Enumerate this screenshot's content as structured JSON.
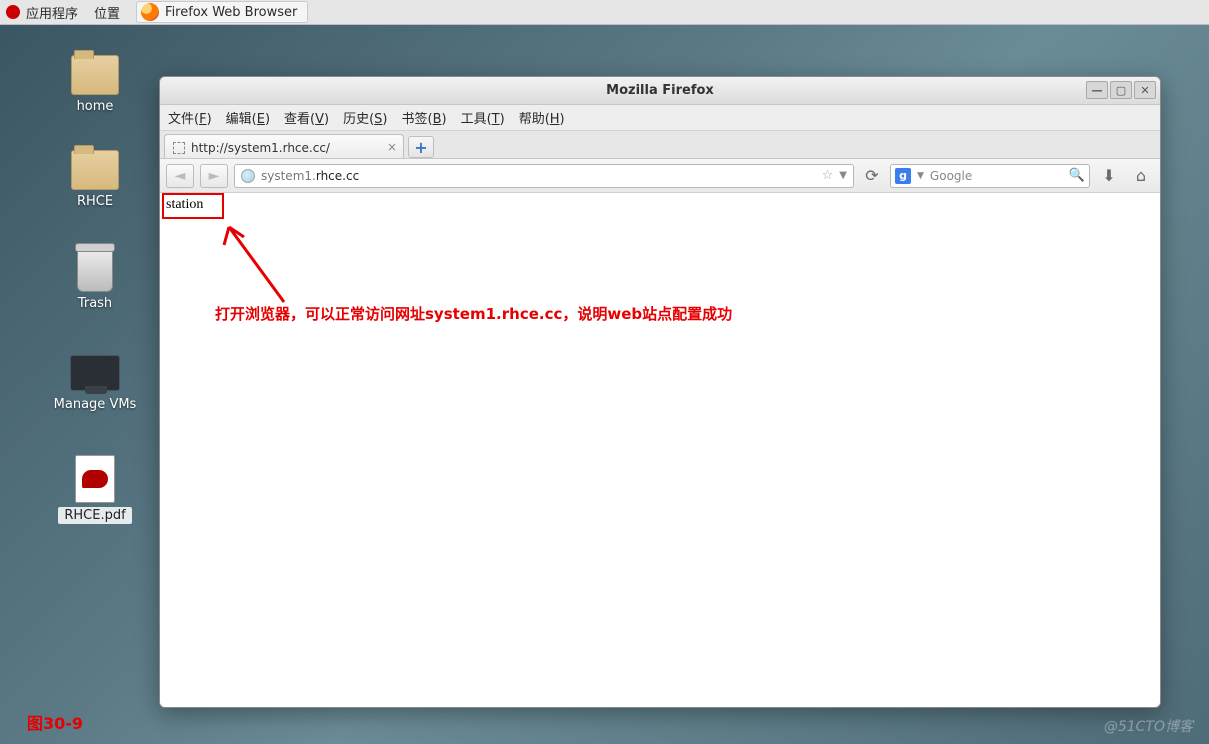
{
  "panel": {
    "apps": "应用程序",
    "places": "位置",
    "task": "Firefox Web Browser"
  },
  "desktop": {
    "home": "home",
    "rhce": "RHCE",
    "trash": "Trash",
    "managevms": "Manage VMs",
    "rhcepdf": "RHCE.pdf"
  },
  "window": {
    "title": "Mozilla Firefox",
    "menus": {
      "file": "文件(",
      "file_u": "F",
      "file2": ")",
      "edit": "编辑(",
      "edit_u": "E",
      "edit2": ")",
      "view": "查看(",
      "view_u": "V",
      "view2": ")",
      "history": "历史(",
      "history_u": "S",
      "history2": ")",
      "bookmarks": "书签(",
      "bookmarks_u": "B",
      "bookmarks2": ")",
      "tools": "工具(",
      "tools_u": "T",
      "tools2": ")",
      "help": "帮助(",
      "help_u": "H",
      "help2": ")"
    },
    "tab_title": "http://system1.rhce.cc/",
    "url_gray1": "system1.",
    "url_dark": "rhce.cc",
    "search_placeholder": "Google",
    "page_text": "station"
  },
  "annotation": {
    "text": "打开浏览器，可以正常访问网址system1.rhce.cc，说明web站点配置成功"
  },
  "figure_label": "图30-9",
  "watermark": "@51CTO博客"
}
